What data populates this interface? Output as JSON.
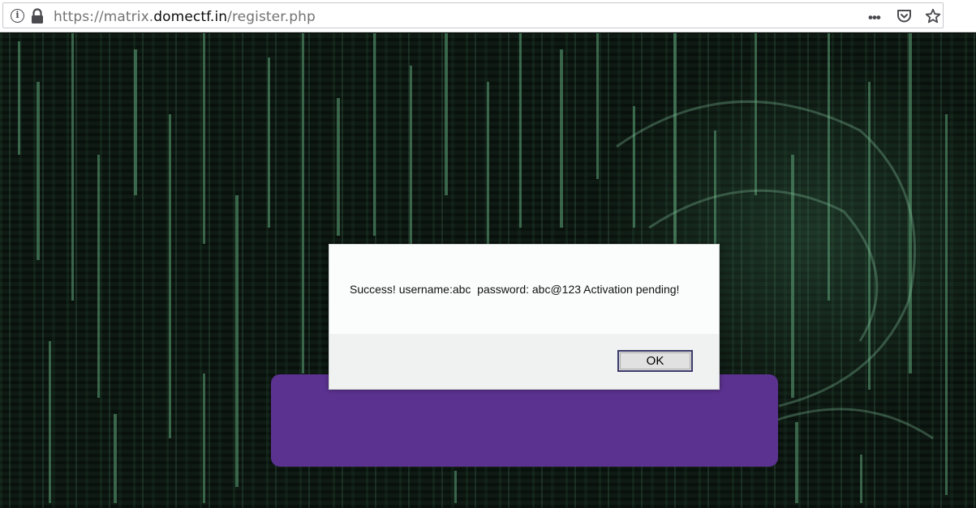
{
  "browser": {
    "url_scheme": "https://matrix.",
    "url_host": "domectf.in",
    "url_path": "/register.php",
    "icons": [
      "info-icon",
      "lock-icon",
      "more-icon",
      "pocket-icon",
      "star-icon"
    ]
  },
  "dialog": {
    "message": "Success! username:abc  password: abc@123 Activation pending!",
    "ok_label": "OK"
  },
  "colors": {
    "panel": "#5b3290",
    "background": "#0e1a13",
    "matrix_green": "#5fa67a"
  }
}
